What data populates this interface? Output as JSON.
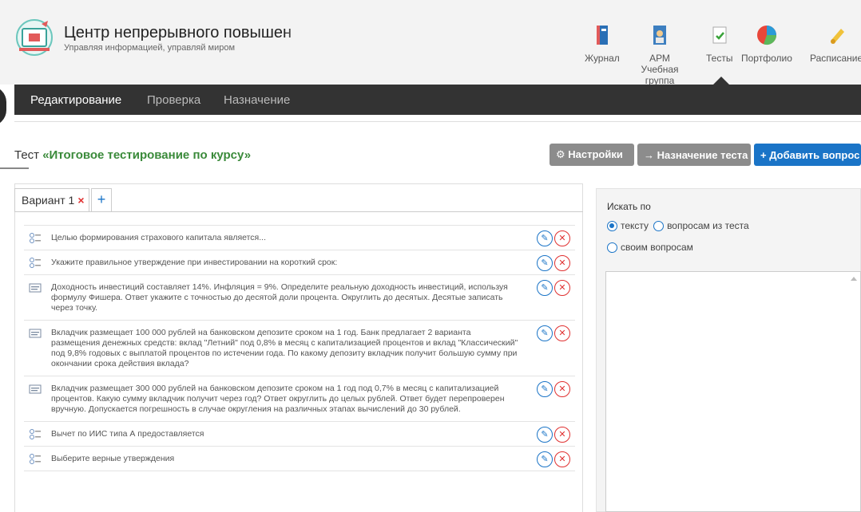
{
  "header": {
    "title": "Центр непрерывного повышен",
    "subtitle": "Управляя информацией, управляй миром"
  },
  "nav": [
    {
      "label": "Журнал",
      "icon": "journal-icon"
    },
    {
      "label": "АРМ Учебная группа",
      "icon": "group-icon"
    },
    {
      "label": "Тесты",
      "icon": "tests-icon",
      "active": true
    },
    {
      "label": "Портфолио",
      "icon": "portfolio-icon"
    },
    {
      "label": "Расписание",
      "icon": "schedule-icon"
    }
  ],
  "tabs": {
    "edit": "Редактирование",
    "check": "Проверка",
    "assign": "Назначение"
  },
  "test": {
    "prefix": "Тест",
    "name": "«Итоговое тестирование по курсу»"
  },
  "buttons": {
    "settings": "⚙ Настройки",
    "assign_test": "→ Назначение теста",
    "add_question": "+ Добавить вопрос"
  },
  "variant": {
    "label": "Вариант 1",
    "close": "×",
    "add": "+"
  },
  "questions": [
    {
      "type": "choice",
      "text": "Целью формирования страхового капитала является..."
    },
    {
      "type": "choice",
      "text": "Укажите правильное утверждение при инвестировании на короткий срок:"
    },
    {
      "type": "text",
      "text": "Доходность инвестиций составляет 14%. Инфляция = 9%. Определите реальную доходность инвестиций, используя формулу Фишера. Ответ укажите с точностью до десятой доли процента. Округлить до десятых. Десятые записать через точку."
    },
    {
      "type": "text",
      "text": "Вкладчик размещает 100 000 рублей на банковском депозите сроком на 1 год. Банк предлагает 2 варианта размещения денежных средств: вклад \"Летний\" под 0,8% в месяц с капитализацией процентов и вклад \"Классический\" под 9,8% годовых с выплатой процентов по истечении года. По какому депозиту вкладчик получит большую сумму при окончании срока действия вклада?"
    },
    {
      "type": "text",
      "text": "Вкладчик размещает 300 000 рублей на банковском депозите сроком на 1 год под 0,7% в месяц с капитализацией процентов. Какую сумму вкладчик получит через год? Ответ округлить до целых рублей. Ответ будет перепроверен вручную. Допускается погрешность в случае округления на различных этапах вычислений до 30 рублей."
    },
    {
      "type": "choice",
      "text": "Вычет по ИИС типа А предоставляется"
    },
    {
      "type": "choice",
      "text": "Выберите верные утверждения"
    }
  ],
  "search": {
    "label": "Искать по",
    "options": [
      "тексту",
      "вопросам из теста",
      "своим вопросам"
    ],
    "selected": "тексту"
  },
  "colors": {
    "accent": "#1a74c7",
    "danger": "#e03030",
    "test_name": "#3a8a3a",
    "dark_bar": "#333333"
  }
}
